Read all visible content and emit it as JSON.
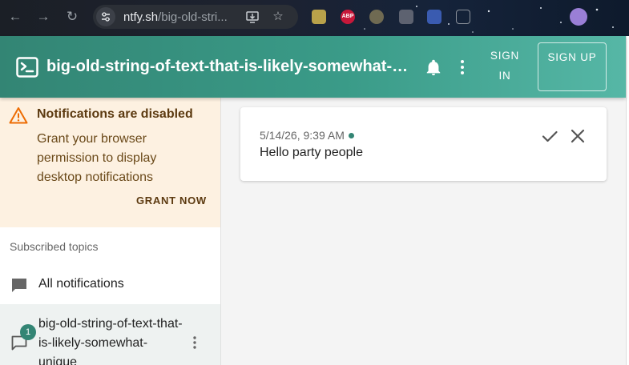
{
  "browser": {
    "url_host": "ntfy.sh",
    "url_path": "/big-old-stri...",
    "extensions": [
      {
        "name": "extension-1",
        "color": "#b9a24a",
        "text": ""
      },
      {
        "name": "adblock-plus",
        "color": "#c7183a",
        "text": "ABP"
      },
      {
        "name": "extension-3",
        "color": "#6f6a52",
        "text": ""
      },
      {
        "name": "extension-4",
        "color": "#5d6270",
        "text": ""
      },
      {
        "name": "extension-5",
        "color": "#3a5bb0",
        "text": ""
      }
    ]
  },
  "appbar": {
    "title": "big-old-string-of-text-that-is-likely-somewhat-uni…",
    "sign_in": "SIGN IN",
    "sign_up": "SIGN UP"
  },
  "sidebar": {
    "alert": {
      "title": "Notifications are disabled",
      "text": "Grant your browser permission to display desktop notifications",
      "action": "GRANT NOW"
    },
    "topics_header": "Subscribed topics",
    "all_notifications": "All notifications",
    "topic": {
      "label": "big-old-string-of-text-that-is-likely-somewhat-unique",
      "badge": "1"
    }
  },
  "notification": {
    "time": "5/14/26, 9:39 AM",
    "message": "Hello party people"
  },
  "colors": {
    "brand": "#338574",
    "alert_bg": "#fdf1e1",
    "warning": "#ed6c02"
  }
}
